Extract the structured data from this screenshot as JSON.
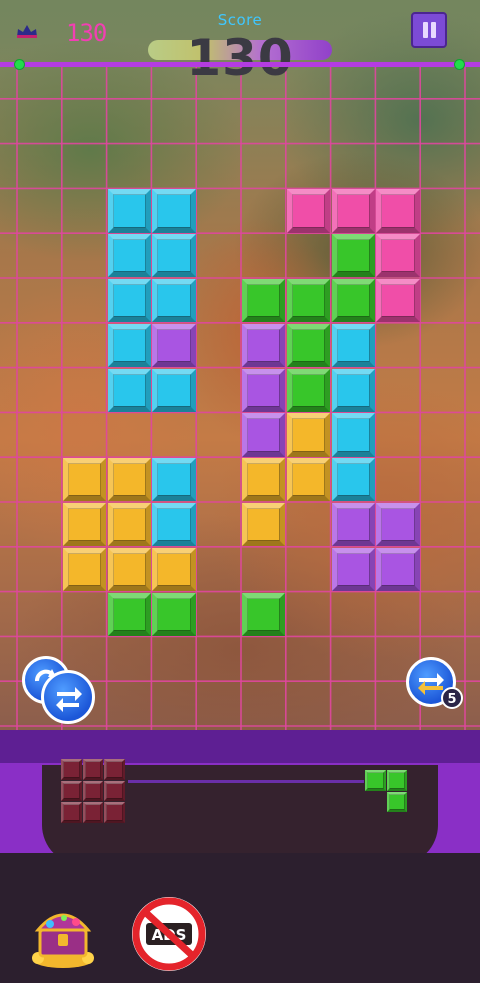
{
  "header": {
    "best_score": "130",
    "score_label": "Score",
    "score_value": "130",
    "score_progress": 0.5
  },
  "colors": {
    "cyan": "#29c6ec",
    "pink": "#f04ea8",
    "green": "#38c62a",
    "purple": "#a955e2",
    "yellow": "#f4b72a",
    "maroon": "#7a2235",
    "grid_line": "#e0479f",
    "accent": "#8a2fc6"
  },
  "board": {
    "cols": 11,
    "rows": 16,
    "cells": [
      {
        "c": 2,
        "r": 3,
        "color": "cyan"
      },
      {
        "c": 3,
        "r": 3,
        "color": "cyan"
      },
      {
        "c": 2,
        "r": 4,
        "color": "cyan"
      },
      {
        "c": 3,
        "r": 4,
        "color": "cyan"
      },
      {
        "c": 2,
        "r": 5,
        "color": "cyan"
      },
      {
        "c": 3,
        "r": 5,
        "color": "cyan"
      },
      {
        "c": 2,
        "r": 6,
        "color": "cyan"
      },
      {
        "c": 3,
        "r": 6,
        "color": "purple"
      },
      {
        "c": 2,
        "r": 7,
        "color": "cyan"
      },
      {
        "c": 3,
        "r": 7,
        "color": "cyan"
      },
      {
        "c": 6,
        "r": 3,
        "color": "pink"
      },
      {
        "c": 7,
        "r": 3,
        "color": "pink"
      },
      {
        "c": 8,
        "r": 3,
        "color": "pink"
      },
      {
        "c": 7,
        "r": 4,
        "color": "green"
      },
      {
        "c": 8,
        "r": 4,
        "color": "pink"
      },
      {
        "c": 5,
        "r": 5,
        "color": "green"
      },
      {
        "c": 6,
        "r": 5,
        "color": "green"
      },
      {
        "c": 7,
        "r": 5,
        "color": "green"
      },
      {
        "c": 8,
        "r": 5,
        "color": "pink"
      },
      {
        "c": 5,
        "r": 6,
        "color": "purple"
      },
      {
        "c": 6,
        "r": 6,
        "color": "green"
      },
      {
        "c": 7,
        "r": 6,
        "color": "cyan"
      },
      {
        "c": 5,
        "r": 7,
        "color": "purple"
      },
      {
        "c": 6,
        "r": 7,
        "color": "green"
      },
      {
        "c": 7,
        "r": 7,
        "color": "cyan"
      },
      {
        "c": 5,
        "r": 8,
        "color": "purple"
      },
      {
        "c": 6,
        "r": 8,
        "color": "yellow"
      },
      {
        "c": 7,
        "r": 8,
        "color": "cyan"
      },
      {
        "c": 1,
        "r": 9,
        "color": "yellow"
      },
      {
        "c": 2,
        "r": 9,
        "color": "yellow"
      },
      {
        "c": 3,
        "r": 9,
        "color": "cyan"
      },
      {
        "c": 5,
        "r": 9,
        "color": "yellow"
      },
      {
        "c": 6,
        "r": 9,
        "color": "yellow"
      },
      {
        "c": 7,
        "r": 9,
        "color": "cyan"
      },
      {
        "c": 1,
        "r": 10,
        "color": "yellow"
      },
      {
        "c": 2,
        "r": 10,
        "color": "yellow"
      },
      {
        "c": 3,
        "r": 10,
        "color": "cyan"
      },
      {
        "c": 5,
        "r": 10,
        "color": "yellow"
      },
      {
        "c": 7,
        "r": 10,
        "color": "purple"
      },
      {
        "c": 8,
        "r": 10,
        "color": "purple"
      },
      {
        "c": 1,
        "r": 11,
        "color": "yellow"
      },
      {
        "c": 2,
        "r": 11,
        "color": "yellow"
      },
      {
        "c": 3,
        "r": 11,
        "color": "yellow"
      },
      {
        "c": 7,
        "r": 11,
        "color": "purple"
      },
      {
        "c": 8,
        "r": 11,
        "color": "purple"
      },
      {
        "c": 2,
        "r": 12,
        "color": "green"
      },
      {
        "c": 3,
        "r": 12,
        "color": "green"
      },
      {
        "c": 5,
        "r": 12,
        "color": "green"
      }
    ]
  },
  "powerups": {
    "swap_badge_count": "5"
  },
  "pieces": [
    {
      "name": "maroon-square-piece",
      "color": "maroon",
      "cells": [
        [
          0,
          0
        ],
        [
          1,
          0
        ],
        [
          2,
          0
        ],
        [
          0,
          1
        ],
        [
          1,
          1
        ],
        [
          2,
          1
        ],
        [
          0,
          2
        ],
        [
          1,
          2
        ],
        [
          2,
          2
        ]
      ]
    },
    {
      "name": "green-corner-piece",
      "color": "green",
      "cells": [
        [
          0,
          0
        ],
        [
          1,
          0
        ],
        [
          1,
          1
        ]
      ]
    }
  ],
  "footer": {
    "no_ads_text": "ADS"
  }
}
